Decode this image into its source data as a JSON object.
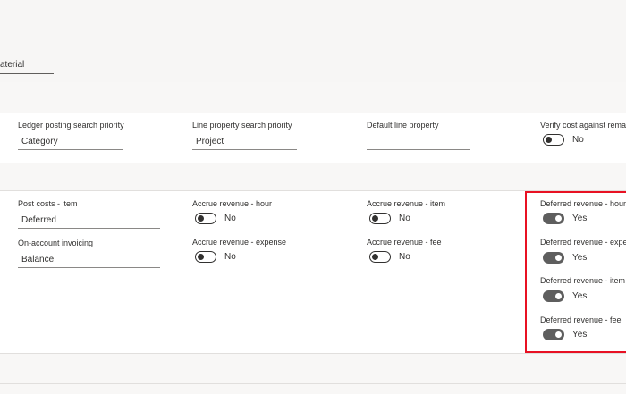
{
  "header": {
    "field_value": "aterial"
  },
  "section1": {
    "ledger_posting_search_priority": {
      "label": "Ledger posting search priority",
      "value": "Category"
    },
    "line_property_search_priority": {
      "label": "Line property search priority",
      "value": "Project"
    },
    "default_line_property": {
      "label": "Default line property",
      "value": ""
    },
    "verify_cost": {
      "label": "Verify cost against remai",
      "value": "No"
    }
  },
  "section2": {
    "post_costs_item": {
      "label": "Post costs - item",
      "value": "Deferred"
    },
    "on_account_invoicing": {
      "label": "On-account invoicing",
      "value": "Balance"
    },
    "accrue_revenue_hour": {
      "label": "Accrue revenue - hour",
      "value": "No"
    },
    "accrue_revenue_expense": {
      "label": "Accrue revenue - expense",
      "value": "No"
    },
    "accrue_revenue_item": {
      "label": "Accrue revenue - item",
      "value": "No"
    },
    "accrue_revenue_fee": {
      "label": "Accrue revenue - fee",
      "value": "No"
    },
    "deferred_revenue_hour": {
      "label": "Deferred revenue - hour",
      "value": "Yes"
    },
    "deferred_revenue_expense": {
      "label": "Deferred revenue - expe",
      "value": "Yes"
    },
    "deferred_revenue_item": {
      "label": "Deferred revenue - item",
      "value": "Yes"
    },
    "deferred_revenue_fee": {
      "label": "Deferred revenue - fee",
      "value": "Yes"
    }
  },
  "colors": {
    "highlight": "#e81123",
    "toggle_on": "#5e5e5e"
  }
}
